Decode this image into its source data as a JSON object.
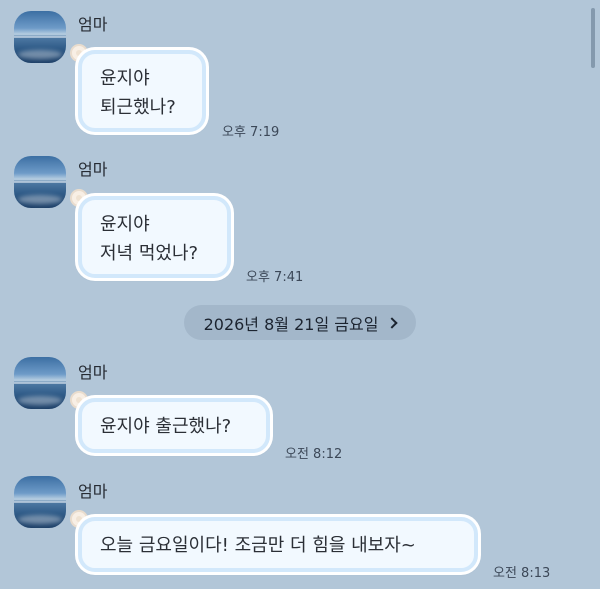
{
  "messages": [
    {
      "sender": "엄마",
      "lines": [
        "윤지야",
        "퇴근했나?"
      ],
      "time": "오후 7:19"
    },
    {
      "sender": "엄마",
      "lines": [
        "윤지야",
        "저녁 먹었나?"
      ],
      "time": "오후 7:41"
    },
    {
      "sender": "엄마",
      "lines": [
        "윤지야 출근했나?"
      ],
      "time": "오전 8:12"
    },
    {
      "sender": "엄마",
      "lines": [
        "오늘 금요일이다! 조금만 더 힘을 내보자~"
      ],
      "time": "오전 8:13"
    }
  ],
  "date_divider": {
    "label": "2026년 8월 21일 금요일"
  },
  "icons": {
    "avatar": "profile-photo-ocean",
    "bow": "bubble-decoration",
    "chevron": "chevron-right-icon"
  },
  "colors": {
    "background": "#b2c6d8",
    "bubble_fill": "#f2f9ff",
    "bubble_border": "#d2e8fb",
    "date_pill": "#a3b7ca"
  }
}
